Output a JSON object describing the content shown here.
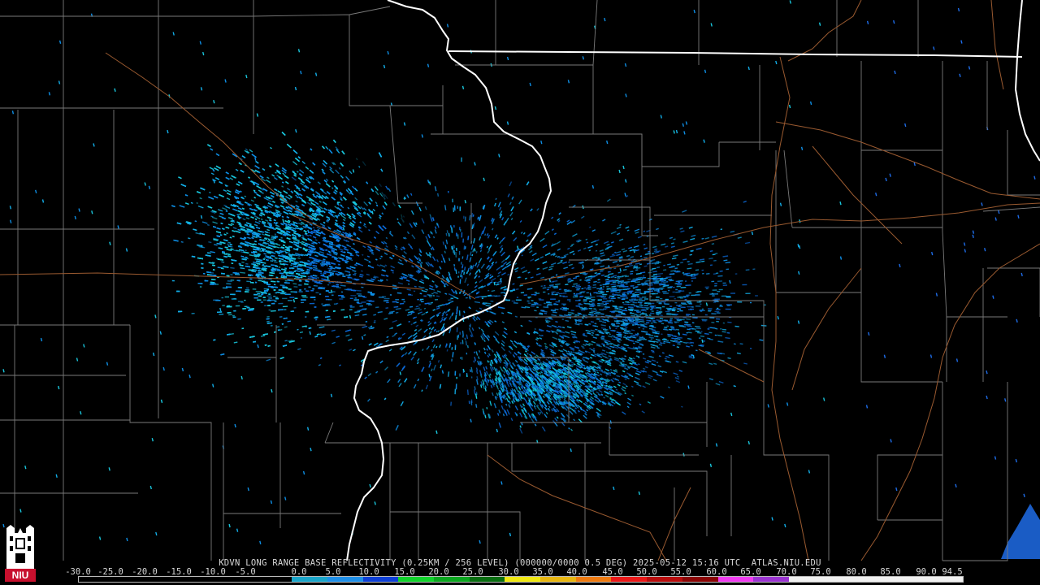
{
  "product_title": "KDVN LONG RANGE BASE REFLECTIVITY (0.25KM / 256 LEVEL) (000000/0000 0.5 DEG) 2025-05-12 15:16 UTC  ATLAS.NIU.EDU",
  "logo_text": "NIU",
  "colorbar": {
    "labels": [
      "-30.0",
      "-25.0",
      "-20.0",
      "-15.0",
      "-10.0",
      "-5.0",
      "0.0",
      "5.0",
      "10.0",
      "15.0",
      "20.0",
      "25.0",
      "30.0",
      "35.0",
      "40.0",
      "45.0",
      "50.0",
      "55.0",
      "60.0",
      "65.0",
      "70.0",
      "75.0",
      "80.0",
      "85.0",
      "90.0",
      "94.5"
    ],
    "segment_colors": [
      "#000000",
      "#000000",
      "#000000",
      "#000000",
      "#000000",
      "#000000",
      "#1aa5c9",
      "#1e8fe8",
      "#0e3fd6",
      "#11d22b",
      "#0aa61e",
      "#086d10",
      "#f0e812",
      "#e8b610",
      "#ee7a10",
      "#ea1818",
      "#b80c0c",
      "#8a0404",
      "#f03cf0",
      "#9a34d0",
      "#f0f0f0",
      "#f0f0f0",
      "#f0f0f0",
      "#f0f0f0",
      "#f0f0f0"
    ],
    "echo_colors": [
      "#19c6dc",
      "#12aee8",
      "#0e8ee4",
      "#0c6ad8",
      "#13d3e6"
    ]
  }
}
